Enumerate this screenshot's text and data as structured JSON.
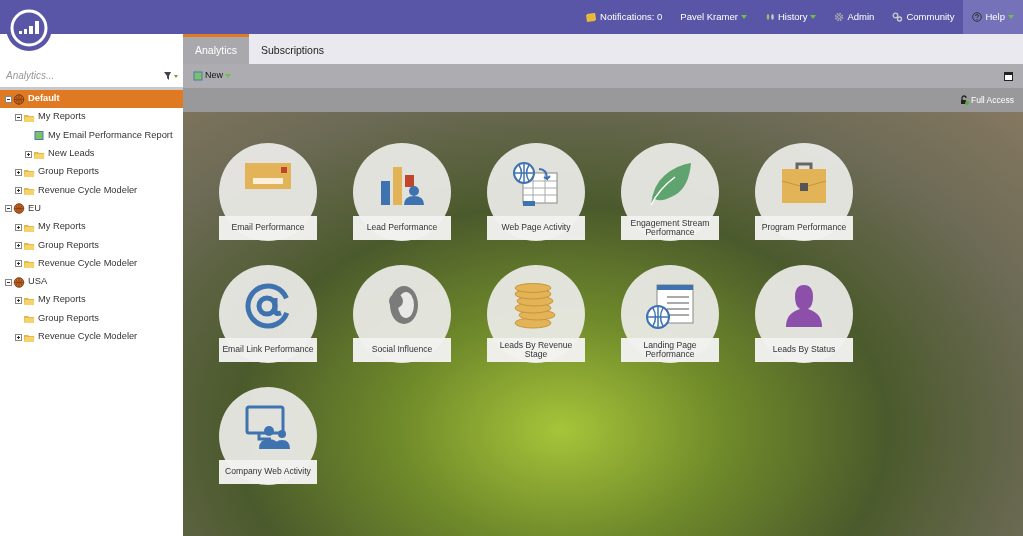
{
  "top_nav": [
    {
      "label": "Notifications: 0",
      "kind": "notifications",
      "has_menu": false,
      "highlighted": false
    },
    {
      "label": "Pavel Kramer",
      "kind": "user",
      "has_menu": true,
      "highlighted": false
    },
    {
      "label": "History",
      "kind": "history",
      "has_menu": true,
      "highlighted": false
    },
    {
      "label": "Admin",
      "kind": "admin",
      "has_menu": false,
      "highlighted": false
    },
    {
      "label": "Community",
      "kind": "community",
      "has_menu": false,
      "highlighted": false
    },
    {
      "label": "Help",
      "kind": "help",
      "has_menu": true,
      "highlighted": true
    }
  ],
  "sidebar": {
    "search": {
      "placeholder": "Analytics..."
    },
    "tree": [
      {
        "label": "Default",
        "kind": "workspace",
        "expandable": true,
        "expanded": true,
        "selected": true,
        "children": [
          {
            "label": "My Reports",
            "kind": "folder",
            "expandable": true,
            "expanded": true,
            "selected": false,
            "children": [
              {
                "label": "My Email Performance Report",
                "kind": "report",
                "expandable": false,
                "selected": false
              },
              {
                "label": "New Leads",
                "kind": "folder",
                "expandable": true,
                "expanded": false,
                "selected": false
              }
            ]
          },
          {
            "label": "Group Reports",
            "kind": "folder",
            "expandable": true,
            "expanded": false,
            "selected": false
          },
          {
            "label": "Revenue Cycle Modeler",
            "kind": "folder",
            "expandable": true,
            "expanded": false,
            "selected": false
          }
        ]
      },
      {
        "label": "EU",
        "kind": "workspace",
        "expandable": true,
        "expanded": true,
        "selected": false,
        "children": [
          {
            "label": "My Reports",
            "kind": "folder",
            "expandable": true,
            "expanded": false,
            "selected": false
          },
          {
            "label": "Group Reports",
            "kind": "folder",
            "expandable": true,
            "expanded": false,
            "selected": false
          },
          {
            "label": "Revenue Cycle Modeler",
            "kind": "folder",
            "expandable": true,
            "expanded": false,
            "selected": false
          }
        ]
      },
      {
        "label": "USA",
        "kind": "workspace",
        "expandable": true,
        "expanded": true,
        "selected": false,
        "children": [
          {
            "label": "My Reports",
            "kind": "folder",
            "expandable": true,
            "expanded": false,
            "selected": false
          },
          {
            "label": "Group Reports",
            "kind": "folder",
            "expandable": false,
            "selected": false
          },
          {
            "label": "Revenue Cycle Modeler",
            "kind": "folder",
            "expandable": true,
            "expanded": false,
            "selected": false
          }
        ]
      }
    ]
  },
  "tabs": [
    {
      "label": "Analytics",
      "selected": true
    },
    {
      "label": "Subscriptions",
      "selected": false
    }
  ],
  "toolbar": {
    "new_button": "New"
  },
  "access_bar": {
    "label": "Full Access"
  },
  "tiles": [
    {
      "label": "Email Performance",
      "kind": "email"
    },
    {
      "label": "Lead Performance",
      "kind": "lead"
    },
    {
      "label": "Web Page Activity",
      "kind": "webpage"
    },
    {
      "label": "Engagement Stream Performance",
      "kind": "leaf"
    },
    {
      "label": "Program Performance",
      "kind": "program"
    },
    {
      "label": "Email Link Performance",
      "kind": "at"
    },
    {
      "label": "Social Influence",
      "kind": "social"
    },
    {
      "label": "Leads By Revenue Stage",
      "kind": "coins"
    },
    {
      "label": "Landing Page Performance",
      "kind": "landing"
    },
    {
      "label": "Leads By Status",
      "kind": "person"
    },
    {
      "label": "Company Web Activity",
      "kind": "company"
    }
  ]
}
